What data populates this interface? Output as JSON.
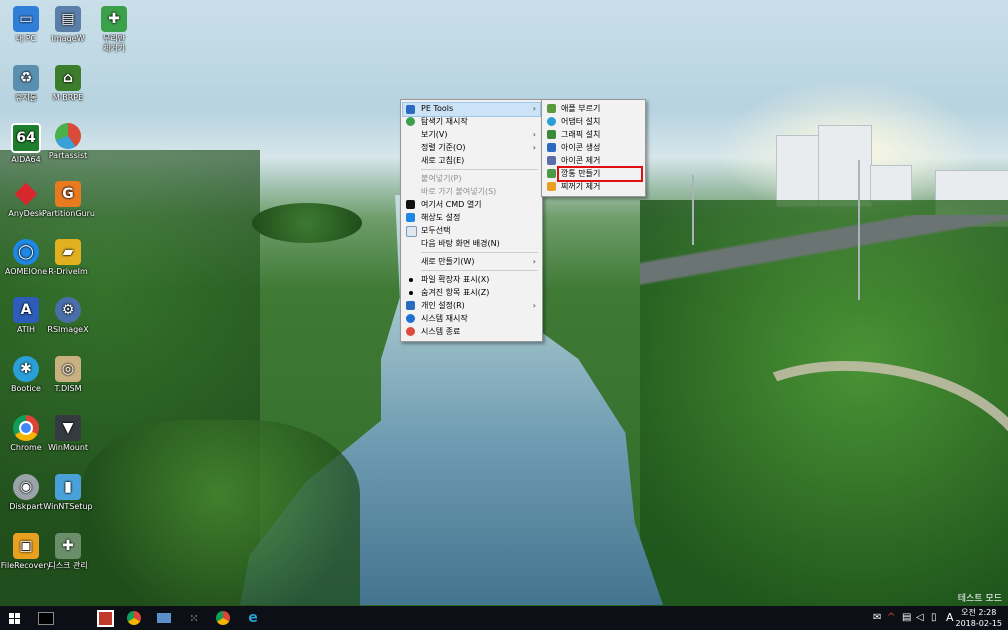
{
  "desktop_icons": [
    {
      "label": "내 PC",
      "icon": "this-pc-icon",
      "color": "#2f7ed8"
    },
    {
      "label": "휴지통",
      "icon": "recycle-bin-icon",
      "color": "#5b8fb0"
    },
    {
      "label": "AIDA64",
      "icon": "aida64-icon",
      "color": "#1e7e2e"
    },
    {
      "label": "AnyDesk",
      "icon": "anydesk-icon",
      "color": "#d8262d"
    },
    {
      "label": "AOMEIOne",
      "icon": "aomei-icon",
      "color": "#1e88e5"
    },
    {
      "label": "ATIH",
      "icon": "acronis-icon",
      "color": "#2d5db8"
    },
    {
      "label": "Bootice",
      "icon": "bootice-icon",
      "color": "#2a9fd6"
    },
    {
      "label": "Chrome",
      "icon": "chrome-icon",
      "color": "#db4437"
    },
    {
      "label": "Diskpart",
      "icon": "diskpart-icon",
      "color": "#9aa3a8"
    },
    {
      "label": "FileRecovery",
      "icon": "file-recovery-icon",
      "color": "#e8a020"
    },
    {
      "label": "ImageW",
      "icon": "imagew-icon",
      "color": "#5a7fa8"
    },
    {
      "label": "M BRPE",
      "icon": "mbrpe-icon",
      "color": "#3c7d2c"
    },
    {
      "label": "Partassist",
      "icon": "partassist-icon",
      "color": "#d84a3a"
    },
    {
      "label": "PartitionGuru",
      "icon": "partitionguru-icon",
      "color": "#e87a20"
    },
    {
      "label": "R-DriveIm",
      "icon": "rdrive-icon",
      "color": "#e0b020"
    },
    {
      "label": "RSImageX",
      "icon": "rsimagex-icon",
      "color": "#4a6fa8"
    },
    {
      "label": "T.DISM",
      "icon": "tdism-icon",
      "color": "#c8b080"
    },
    {
      "label": "WinMount",
      "icon": "winmount-icon",
      "color": "#333a40"
    },
    {
      "label": "WinNTSetup",
      "icon": "winntsetup-icon",
      "color": "#4aa0d8"
    },
    {
      "label": "디스크 관리",
      "icon": "disk-management-icon",
      "color": "#6a8f6a"
    },
    {
      "label": "무리안\n제거기",
      "icon": "puzzle-icon",
      "color": "#3aa04a"
    }
  ],
  "context_menu": {
    "items": [
      {
        "label": "PE Tools",
        "submenu": true,
        "highlighted": true,
        "icon": "pe-tools-icon"
      },
      {
        "label": "탐색기 재시작",
        "icon": "refresh-icon"
      },
      {
        "label": "보기(V)",
        "submenu": true
      },
      {
        "label": "정렬 기준(O)",
        "submenu": true
      },
      {
        "label": "새로 고침(E)"
      },
      {
        "label": "붙여넣기(P)",
        "disabled": true
      },
      {
        "label": "바로 가기 붙여넣기(S)",
        "disabled": true
      },
      {
        "label": "여기서 CMD 열기",
        "icon": "cmd-icon"
      },
      {
        "label": "해상도 설정",
        "icon": "display-icon"
      },
      {
        "label": "모두선택",
        "icon": "select-all-icon"
      },
      {
        "label": "다음 바탕 화면 배경(N)"
      },
      {
        "label": "새로 만들기(W)",
        "submenu": true
      },
      {
        "label": "파일 확장자 표시(X)",
        "bullet": true
      },
      {
        "label": "숨겨진 항목 표시(Z)",
        "bullet": true
      },
      {
        "label": "개인 설정(R)",
        "submenu": true,
        "icon": "personalize-icon"
      },
      {
        "label": "시스템 재시작",
        "icon": "restart-icon"
      },
      {
        "label": "시스템 종료",
        "icon": "shutdown-icon"
      }
    ]
  },
  "sub_menu": {
    "items": [
      {
        "label": "애플 부르기",
        "icon": "app-load-icon"
      },
      {
        "label": "어댑터 설치",
        "icon": "adapter-icon"
      },
      {
        "label": "그래픽 설치",
        "icon": "graphics-icon"
      },
      {
        "label": "아이콘 생성",
        "icon": "icon-create-icon"
      },
      {
        "label": "아이콘 제거",
        "icon": "icon-remove-icon"
      },
      {
        "label": "깡통 만들기",
        "icon": "make-icon",
        "outlined": true
      },
      {
        "label": "찌꺼기 제거",
        "icon": "clean-icon"
      }
    ]
  },
  "taskbar": {
    "apps": [
      "start-icon",
      "cmd-icon",
      "photoshop-like-icon",
      "chrome-ball-icon",
      "network-icon",
      "grid-icon",
      "chrome-icon",
      "ie-icon"
    ],
    "ime": "A",
    "clock_time": "오전 2:28",
    "clock_date": "2018-02-15"
  },
  "watermark": "테스트 모드",
  "colors": {
    "menu_bg": "#f2f2f2",
    "menu_highlight": "#cce3f7",
    "outline_red": "#e01010",
    "taskbar": "#0c0f16"
  }
}
